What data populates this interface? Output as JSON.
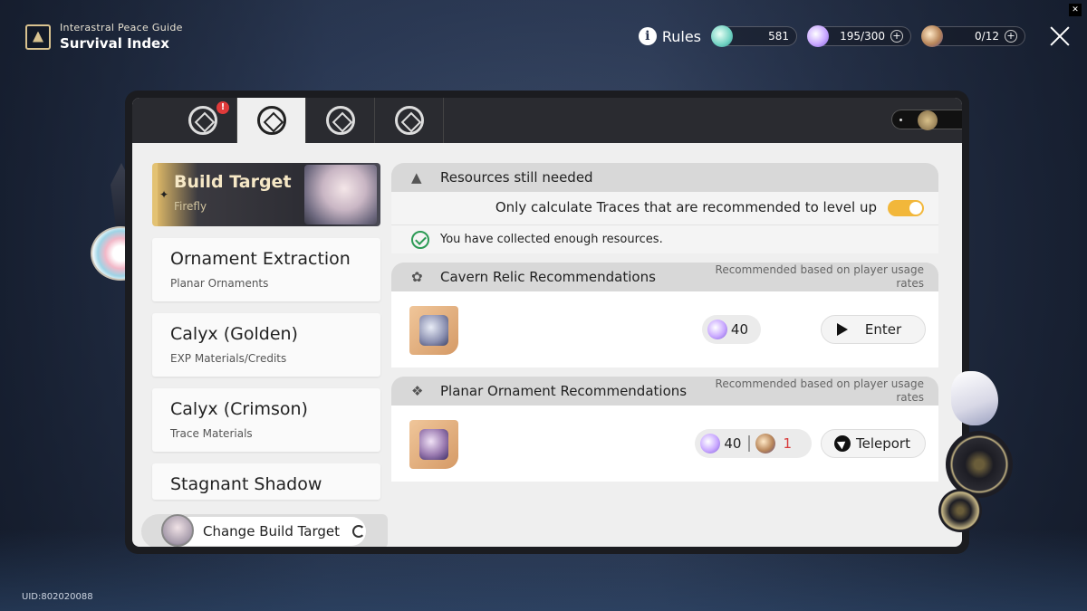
{
  "header": {
    "subtitle": "Interastral Peace Guide",
    "title": "Survival Index"
  },
  "topbar": {
    "rules_label": "Rules",
    "jade": "581",
    "trailblaze_power": "195/300",
    "fuel": "0/12"
  },
  "tabs": [
    {
      "name": "tab-1",
      "icon": "operation-icon",
      "badge": "!"
    },
    {
      "name": "tab-2",
      "icon": "survival-index-icon",
      "active": true
    },
    {
      "name": "tab-3",
      "icon": "simulated-universe-icon"
    },
    {
      "name": "tab-4",
      "icon": "treasures-icon"
    }
  ],
  "left_list": {
    "build": {
      "title": "Build Target",
      "subtitle": "Firefly"
    },
    "items": [
      {
        "title": "Ornament Extraction",
        "subtitle": "Planar Ornaments"
      },
      {
        "title": "Calyx (Golden)",
        "subtitle": "EXP Materials/Credits"
      },
      {
        "title": "Calyx (Crimson)",
        "subtitle": "Trace Materials"
      },
      {
        "title": "Stagnant Shadow",
        "subtitle": ""
      }
    ],
    "change_button": "Change Build Target"
  },
  "resources": {
    "title": "Resources still needed",
    "option_label": "Only calculate Traces that are recommended to level up",
    "option_on": true,
    "status": "You have collected enough resources."
  },
  "cavern": {
    "title": "Cavern Relic Recommendations",
    "note": "Recommended based on player usage rates",
    "cost": "40",
    "action": "Enter"
  },
  "planar": {
    "title": "Planar Ornament Recommendations",
    "note": "Recommended based on player usage rates",
    "cost": "40",
    "fuel_cost": "1",
    "action": "Teleport"
  },
  "uid": "UID:802020088",
  "colors": {
    "toggle": "#f2b73a",
    "badge": "#e03a3a",
    "ok": "#2c9a55",
    "gold": "#d8b466"
  }
}
